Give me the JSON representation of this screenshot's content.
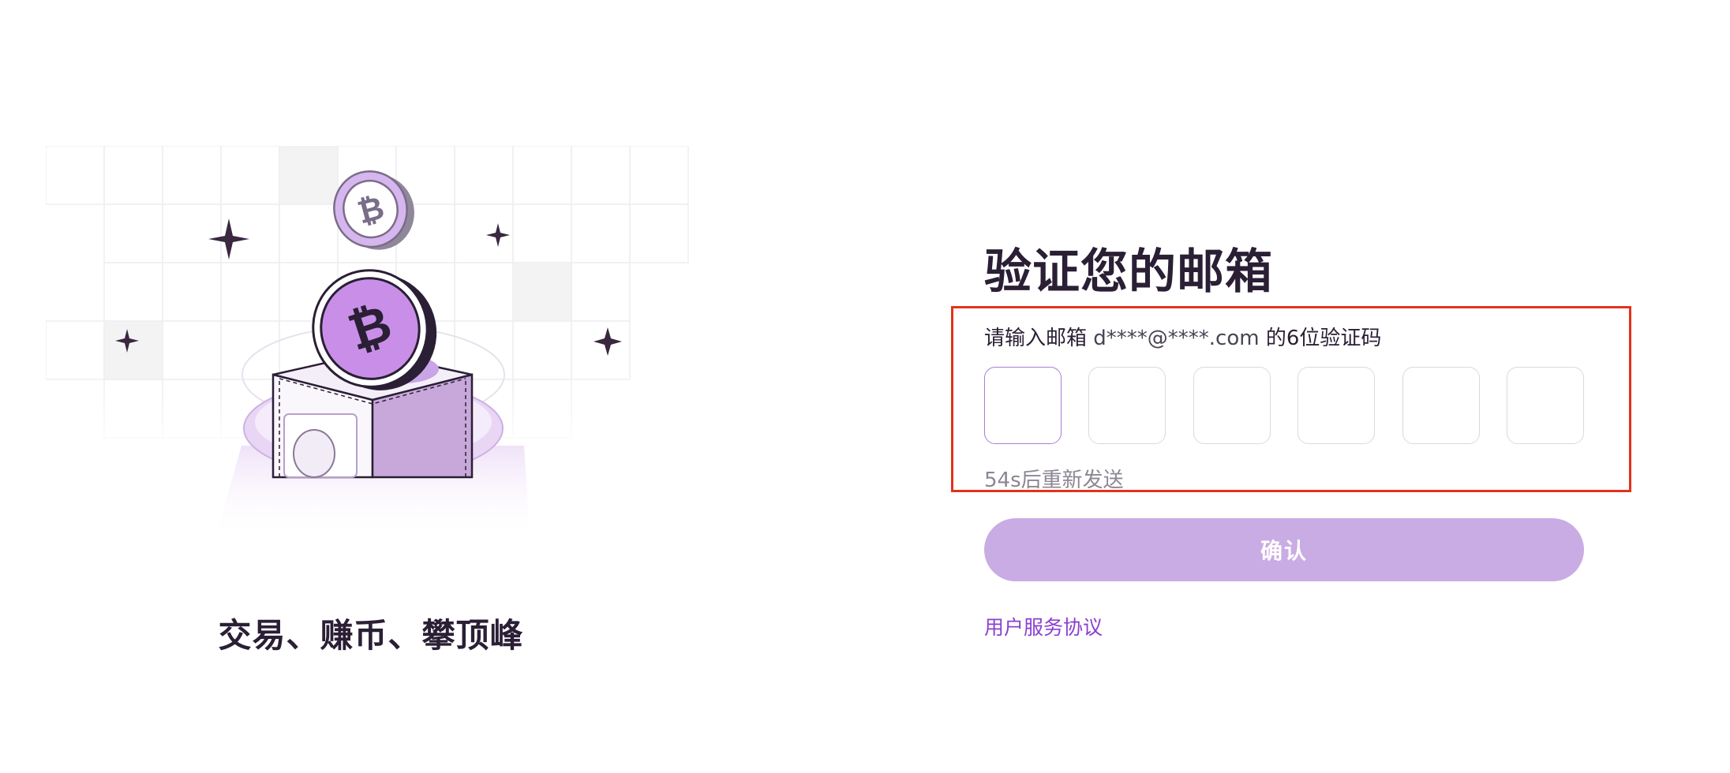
{
  "hero": {
    "tagline": "交易、赚币、攀顶峰"
  },
  "form": {
    "title": "验证您的邮箱",
    "hint_prefix": "请输入邮箱 ",
    "hint_email": "d****@****.com",
    "hint_suffix": " 的6位验证码",
    "code_digits": [
      "",
      "",
      "",
      "",
      "",
      ""
    ],
    "resend_text": "54s后重新发送",
    "confirm_label": "确认",
    "terms_link": "用户服务协议"
  },
  "colors": {
    "accent": "#8a3fd1",
    "button_disabled": "#c9ace4",
    "highlight_border": "#e4321c",
    "active_box_border": "#a77ed6"
  },
  "icons": {
    "coin": "bitcoin-coin-icon",
    "sparkle": "sparkle-icon",
    "safe_box": "safe-box-icon"
  }
}
